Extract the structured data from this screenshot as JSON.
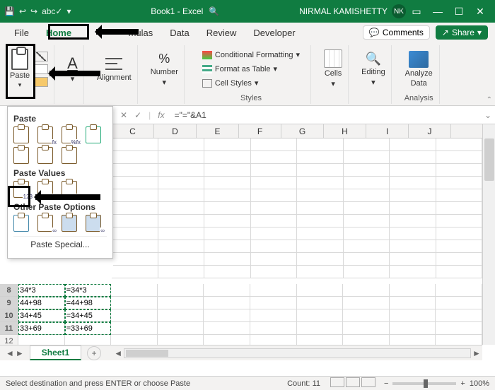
{
  "titlebar": {
    "title": "Book1 - Excel",
    "search_icon": "🔍",
    "user_name": "NIRMAL KAMISHETTY",
    "user_initials": "NK",
    "qat": {
      "undo": "↩",
      "redo": "↪",
      "save": "💾",
      "abc": "abc✓"
    },
    "win": {
      "min": "—",
      "max": "☐",
      "close": "✕"
    }
  },
  "tabs": {
    "file": "File",
    "home": "Home",
    "hidden_insert": "mulas",
    "data": "Data",
    "review": "Review",
    "developer": "Developer",
    "comments": "Comments",
    "share": "Share"
  },
  "ribbon": {
    "clipboard": {
      "paste": "Paste"
    },
    "font_drop": "A",
    "alignment": "Alignment",
    "number": "Number",
    "styles": {
      "cond": "Conditional Formatting",
      "table": "Format as Table",
      "cell": "Cell Styles",
      "label": "Styles"
    },
    "cells": "Cells",
    "editing": "Editing",
    "analyze": {
      "line1": "Analyze",
      "line2": "Data",
      "label": "Analysis"
    }
  },
  "formula_bar": {
    "cancel": "✕",
    "confirm": "✓",
    "fx": "fx",
    "formula": "=\"=\"&A1"
  },
  "columns": [
    "C",
    "D",
    "E",
    "F",
    "G",
    "H",
    "I",
    "J"
  ],
  "rows_visible": {
    "8": {
      "A": "34*3",
      "B": "=34*3"
    },
    "9": {
      "A": "44+98",
      "B": "=44+98"
    },
    "10": {
      "A": "34+45",
      "B": "=34+45"
    },
    "11": {
      "A": "33+69",
      "B": "=33+69"
    },
    "12": {
      "A": "",
      "B": ""
    },
    "13": {
      "A": "",
      "B": ""
    }
  },
  "paste_menu": {
    "title": "Paste",
    "section_values": "Paste Values",
    "section_other": "Other Paste Options",
    "special": "Paste Special...",
    "opt_tags": {
      "fx": "fx",
      "pctfx": "%fx",
      "noborder": "",
      "keepw": "",
      "transpose": "",
      "v123": "123",
      "vpct": "%123",
      "vfmt": "✎"
    }
  },
  "sheet": {
    "name": "Sheet1",
    "add": "+",
    "nav_prev": "◄",
    "nav_next": "►"
  },
  "status": {
    "msg": "Select destination and press ENTER or choose Paste",
    "count_label": "Count:",
    "count_value": "11",
    "zoom": "100%",
    "minus": "−",
    "plus": "+"
  }
}
